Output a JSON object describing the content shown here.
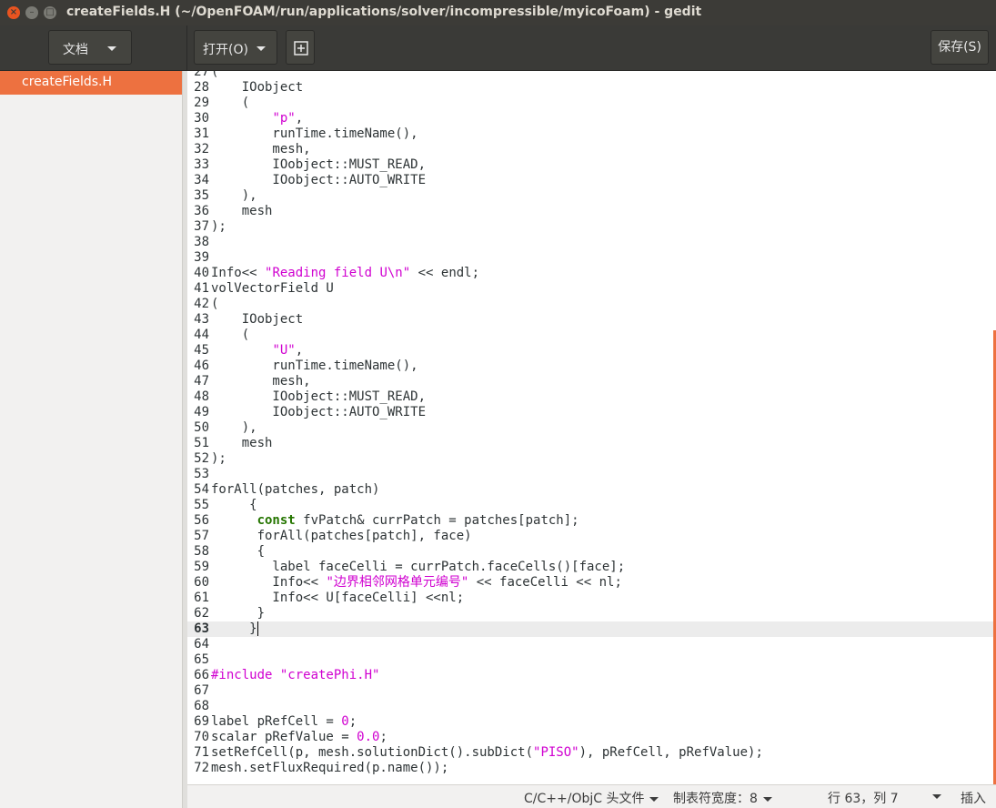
{
  "window": {
    "title": "createFields.H (~/OpenFOAM/run/applications/solver/incompressible/myicoFoam) - gedit",
    "close_glyph": "×",
    "min_glyph": "–",
    "max_glyph": "□"
  },
  "toolbar": {
    "documents_label": "文档",
    "open_label": "打开(O)",
    "save_label": "保存(S)",
    "new_tab_icon": "new-document-icon"
  },
  "sidebar": {
    "items": [
      {
        "label": "createFields.H",
        "selected": true
      }
    ]
  },
  "editor": {
    "current_line": "63",
    "lines": [
      {
        "n": "27",
        "html": "("
      },
      {
        "n": "28",
        "html": "    IOobject"
      },
      {
        "n": "29",
        "html": "    ("
      },
      {
        "n": "30",
        "html": "        <span class=\"str\">\"p\"</span>,"
      },
      {
        "n": "31",
        "html": "        runTime.timeName(),"
      },
      {
        "n": "32",
        "html": "        mesh,"
      },
      {
        "n": "33",
        "html": "        IOobject::MUST_READ,"
      },
      {
        "n": "34",
        "html": "        IOobject::AUTO_WRITE"
      },
      {
        "n": "35",
        "html": "    ),"
      },
      {
        "n": "36",
        "html": "    mesh"
      },
      {
        "n": "37",
        "html": ");"
      },
      {
        "n": "38",
        "html": ""
      },
      {
        "n": "39",
        "html": ""
      },
      {
        "n": "40",
        "html": "Info&lt;&lt; <span class=\"str\">\"Reading field U\\n\"</span> &lt;&lt; endl;"
      },
      {
        "n": "41",
        "html": "volVectorField U"
      },
      {
        "n": "42",
        "html": "("
      },
      {
        "n": "43",
        "html": "    IOobject"
      },
      {
        "n": "44",
        "html": "    ("
      },
      {
        "n": "45",
        "html": "        <span class=\"str\">\"U\"</span>,"
      },
      {
        "n": "46",
        "html": "        runTime.timeName(),"
      },
      {
        "n": "47",
        "html": "        mesh,"
      },
      {
        "n": "48",
        "html": "        IOobject::MUST_READ,"
      },
      {
        "n": "49",
        "html": "        IOobject::AUTO_WRITE"
      },
      {
        "n": "50",
        "html": "    ),"
      },
      {
        "n": "51",
        "html": "    mesh"
      },
      {
        "n": "52",
        "html": ");"
      },
      {
        "n": "53",
        "html": ""
      },
      {
        "n": "54",
        "html": "forAll(patches, patch)"
      },
      {
        "n": "55",
        "html": "     {"
      },
      {
        "n": "56",
        "html": "      <span class=\"kw\">const</span> fvPatch&amp; currPatch = patches[patch];"
      },
      {
        "n": "57",
        "html": "      forAll(patches[patch], face)"
      },
      {
        "n": "58",
        "html": "      {"
      },
      {
        "n": "59",
        "html": "        label faceCelli = currPatch.faceCells()[face];"
      },
      {
        "n": "60",
        "html": "        Info&lt;&lt; <span class=\"str\">\"边界相邻网格单元编号\"</span> &lt;&lt; faceCelli &lt;&lt; nl;"
      },
      {
        "n": "61",
        "html": "        Info&lt;&lt; U[faceCelli] &lt;&lt;nl;"
      },
      {
        "n": "62",
        "html": "      }"
      },
      {
        "n": "63",
        "html": "     }<span class=\"caret\"></span>"
      },
      {
        "n": "64",
        "html": ""
      },
      {
        "n": "65",
        "html": ""
      },
      {
        "n": "66",
        "html": "<span class=\"str\">#include \"createPhi.H\"</span>"
      },
      {
        "n": "67",
        "html": ""
      },
      {
        "n": "68",
        "html": ""
      },
      {
        "n": "69",
        "html": "label pRefCell = <span class=\"str\">0</span>;"
      },
      {
        "n": "70",
        "html": "scalar pRefValue = <span class=\"str\">0.0</span>;"
      },
      {
        "n": "71",
        "html": "setRefCell(p, mesh.solutionDict().subDict(<span class=\"str\">\"PISO\"</span>), pRefCell, pRefValue);"
      },
      {
        "n": "72",
        "html": "mesh.setFluxRequired(p.name());"
      }
    ]
  },
  "statusbar": {
    "language": "C/C++/ObjC 头文件",
    "tab_width": "制表符宽度：8",
    "position": "行 63，列 7",
    "mode": "插入"
  },
  "colors": {
    "accent": "#ed7140",
    "string": "#d000d0",
    "keyword": "#257500",
    "titlebar": "#3c3b37"
  }
}
